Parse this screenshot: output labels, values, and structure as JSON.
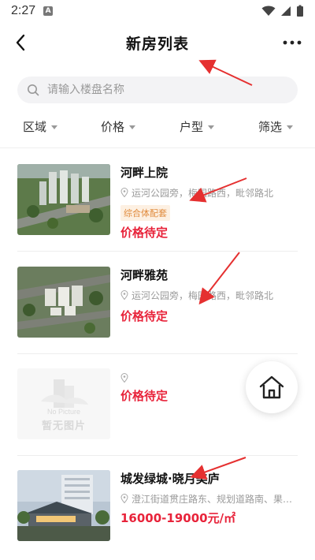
{
  "status_bar": {
    "time": "2:27",
    "sim_label": "A"
  },
  "nav": {
    "title": "新房列表"
  },
  "search": {
    "placeholder": "请输入楼盘名称"
  },
  "filters": [
    "区域",
    "价格",
    "户型",
    "筛选"
  ],
  "listings": [
    {
      "name": "河畔上院",
      "address": "运河公园旁，梅园路西，毗邻路北",
      "tag": "综合体配套",
      "price": "价格待定"
    },
    {
      "name": "河畔雅苑",
      "address": "运河公园旁，梅园路西，毗邻路北",
      "tag": "",
      "price": "价格待定"
    },
    {
      "name": "",
      "address": "",
      "tag": "",
      "price": "价格待定",
      "placeholder_image": {
        "en": "No Picture",
        "cn": "暂无图片"
      }
    },
    {
      "name": "城发绿城·晓月美庐",
      "address": "澄江街道贯庄路东、规划道路南、果…",
      "tag": "",
      "price": "16000-19000元/㎡"
    }
  ],
  "colors": {
    "price": "#e8233a",
    "tag_text": "#e08a3c",
    "tag_bg": "#fdf0e2",
    "annotation_arrow": "#e53030"
  },
  "icons": [
    "back-arrow-icon",
    "more-dots-icon",
    "search-icon",
    "location-pin-icon",
    "home-icon"
  ]
}
